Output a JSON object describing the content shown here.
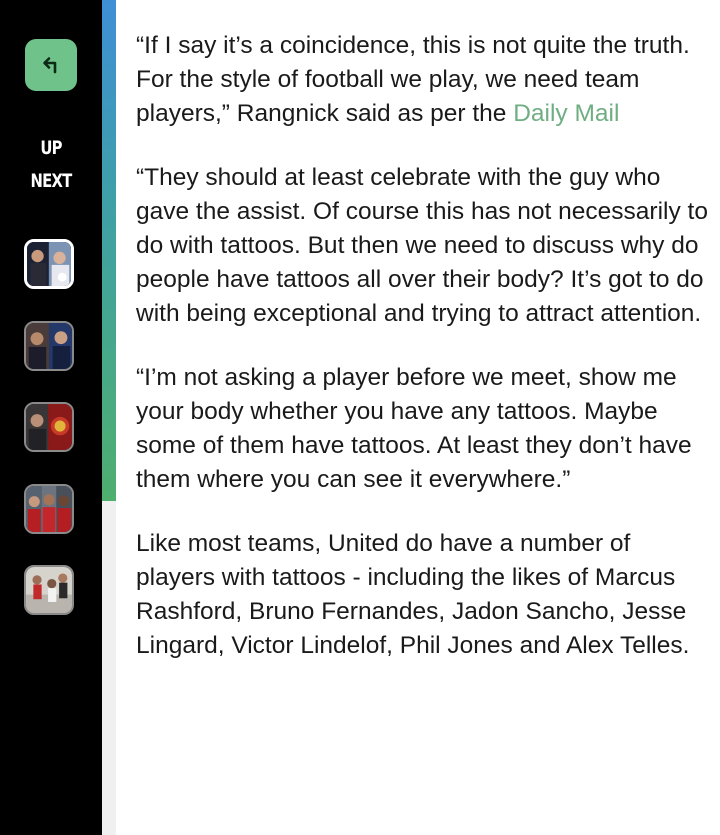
{
  "sidebar": {
    "back_icon": "return-arrow-icon",
    "up_next_line1": "UP",
    "up_next_line2": "NEXT",
    "thumbnails": [
      {
        "icon": "football-photo-thumbnail",
        "active": true
      },
      {
        "icon": "pundits-photo-thumbnail",
        "active": false
      },
      {
        "icon": "manchester-united-crest-thumbnail",
        "active": false
      },
      {
        "icon": "players-photo-thumbnail",
        "active": false
      },
      {
        "icon": "match-action-thumbnail",
        "active": false
      }
    ]
  },
  "reading_progress": 0.6,
  "colors": {
    "accent_green": "#6fc38a",
    "link_green": "#6fae82",
    "sidebar_bg": "#000000",
    "progress_blue": "#3f8fd6",
    "progress_green": "#4faf6e"
  },
  "article": {
    "p1_text": "“If I say it’s a coincidence, this is not quite the truth. For the style of football we play, we need team players,” Rangnick said as per the ",
    "p1_link": "Daily Mail",
    "p2": "“They should at least celebrate with the guy who gave the assist. Of course this has not necessarily to do with tattoos. But then we need to discuss why do people have tattoos all over their body? It’s got to do with being exceptional and trying to attract attention.",
    "p3": "“I’m not asking a player before we meet, show me your body whether you have any tattoos. Maybe some of them have tattoos. At least they don’t have them where you can see it everywhere.”",
    "p4": "Like most teams, United do have a number of players with tattoos - including the likes of Marcus Rashford, Bruno Fernandes, Jadon Sancho, Jesse Lingard, Victor Lindelof, Phil Jones and Alex Telles."
  }
}
